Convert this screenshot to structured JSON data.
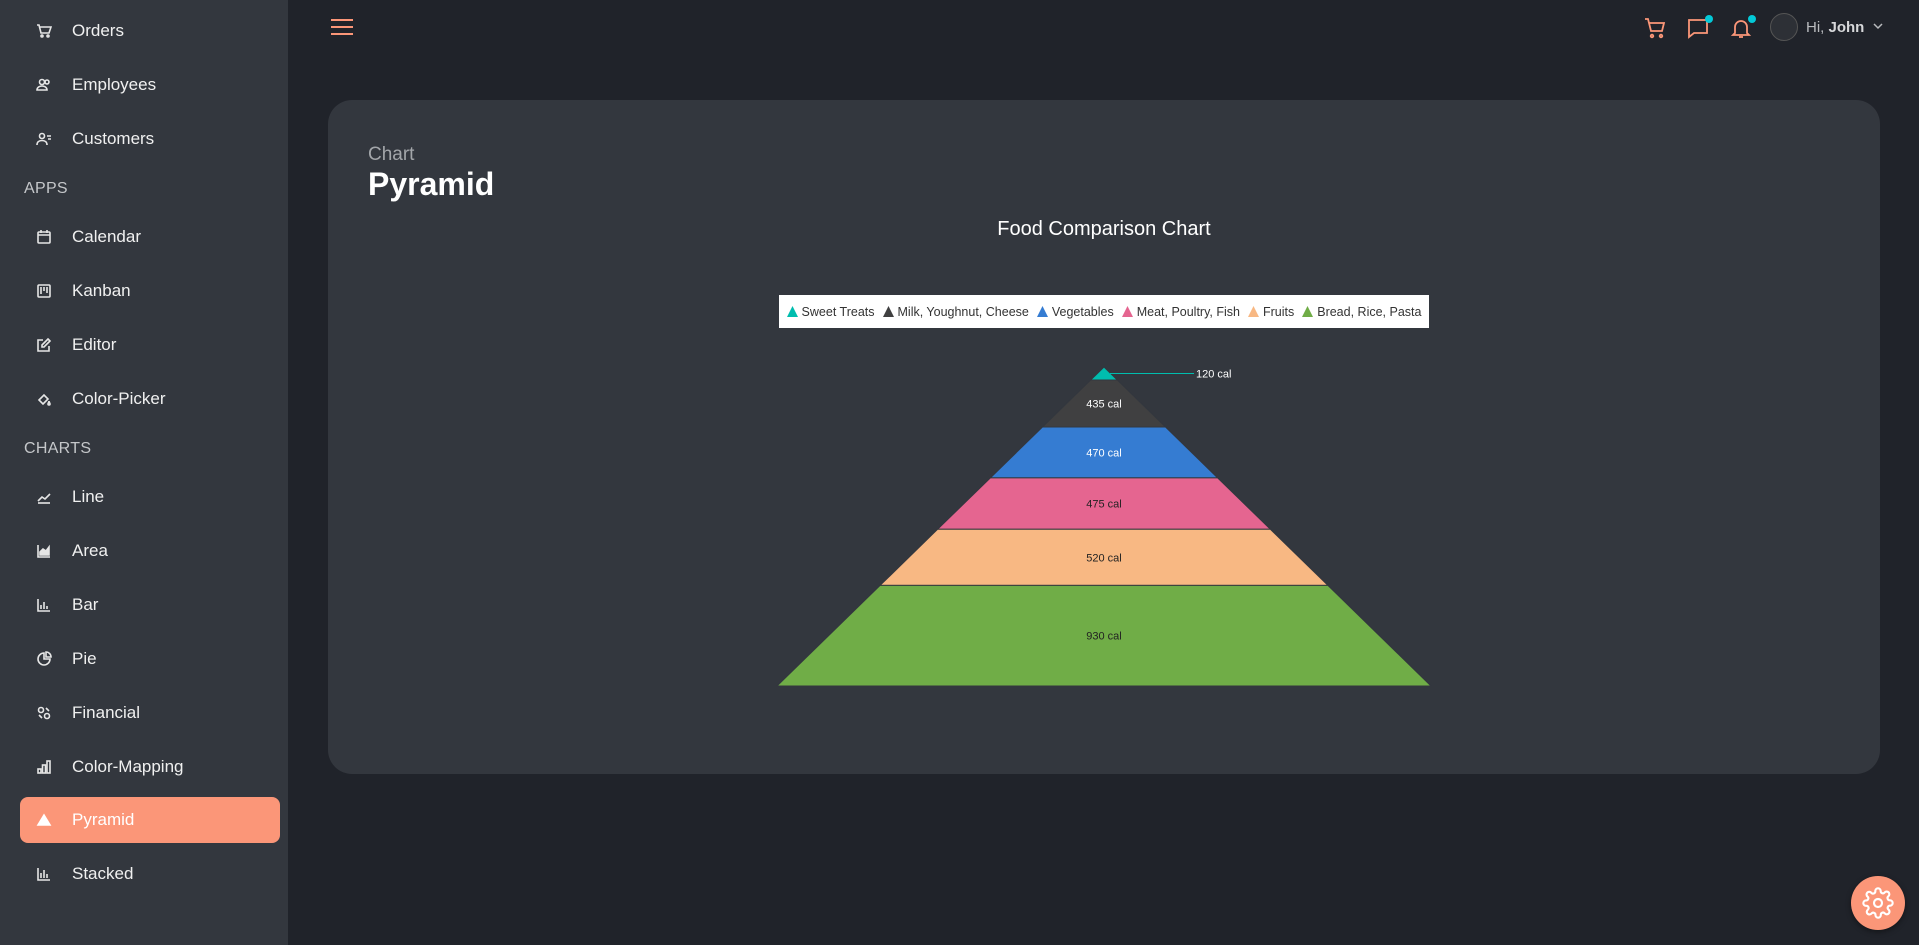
{
  "sidebar": {
    "items": [
      {
        "label": "Orders",
        "icon": "cart-icon"
      },
      {
        "label": "Employees",
        "icon": "employees-icon"
      },
      {
        "label": "Customers",
        "icon": "customers-icon"
      }
    ],
    "apps_heading": "APPS",
    "apps": [
      {
        "label": "Calendar",
        "icon": "calendar-icon"
      },
      {
        "label": "Kanban",
        "icon": "kanban-icon"
      },
      {
        "label": "Editor",
        "icon": "editor-icon"
      },
      {
        "label": "Color-Picker",
        "icon": "color-picker-icon"
      }
    ],
    "charts_heading": "CHARTS",
    "charts": [
      {
        "label": "Line",
        "icon": "line-chart-icon"
      },
      {
        "label": "Area",
        "icon": "area-chart-icon"
      },
      {
        "label": "Bar",
        "icon": "bar-chart-icon"
      },
      {
        "label": "Pie",
        "icon": "pie-chart-icon"
      },
      {
        "label": "Financial",
        "icon": "financial-icon"
      },
      {
        "label": "Color-Mapping",
        "icon": "color-mapping-icon"
      },
      {
        "label": "Pyramid",
        "icon": "pyramid-icon",
        "active": true
      },
      {
        "label": "Stacked",
        "icon": "stacked-chart-icon"
      }
    ]
  },
  "header": {
    "greeting": "Hi,",
    "user_name": "John",
    "accent_color": "#fb9678",
    "notification_dot_color": "#03c9d7"
  },
  "page": {
    "category": "Chart",
    "title": "Pyramid"
  },
  "chart_data": {
    "type": "pyramid",
    "title": "Food Comparison Chart",
    "legend_position": "top",
    "series": [
      {
        "name": "Sweet Treats",
        "value": 120,
        "label": "120 cal",
        "color": "#00bdae"
      },
      {
        "name": "Milk, Youghnut, Cheese",
        "value": 435,
        "label": "435 cal",
        "color": "#404041"
      },
      {
        "name": "Vegetables",
        "value": 470,
        "label": "470 cal",
        "color": "#357cd2"
      },
      {
        "name": "Meat, Poultry, Fish",
        "value": 475,
        "label": "475 cal",
        "color": "#e56590"
      },
      {
        "name": "Fruits",
        "value": 520,
        "label": "520 cal",
        "color": "#f8b883"
      },
      {
        "name": "Bread, Rice, Pasta",
        "value": 930,
        "label": "930 cal",
        "color": "#70ad47"
      }
    ]
  }
}
